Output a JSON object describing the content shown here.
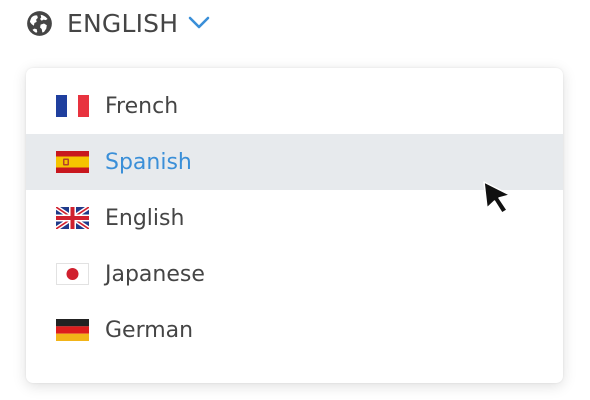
{
  "language_selector": {
    "current_label": "ENGLISH",
    "icon": "globe-icon",
    "chevron_icon": "chevron-down-icon",
    "accent_color": "#3a8fd8"
  },
  "dropdown": {
    "selected_index": 1,
    "options": [
      {
        "label": "French",
        "flag": "flag-france-icon"
      },
      {
        "label": "Spanish",
        "flag": "flag-spain-icon"
      },
      {
        "label": "English",
        "flag": "flag-uk-icon"
      },
      {
        "label": "Japanese",
        "flag": "flag-japan-icon"
      },
      {
        "label": "German",
        "flag": "flag-germany-icon"
      }
    ]
  },
  "pointer": {
    "icon": "mouse-cursor-icon"
  }
}
